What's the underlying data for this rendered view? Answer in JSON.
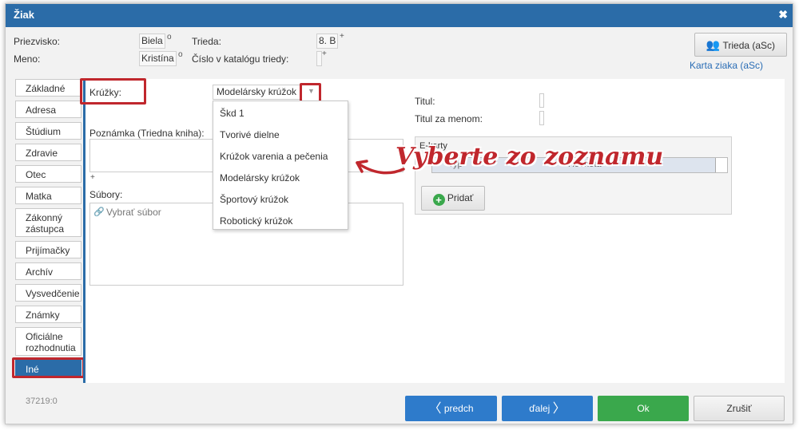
{
  "window": {
    "title": "Žiak"
  },
  "header": {
    "priezvisko_label": "Priezvisko:",
    "priezvisko_value": "Biela",
    "priezvisko_sup": "o",
    "meno_label": "Meno:",
    "meno_value": "Kristína",
    "meno_sup": "o",
    "trieda_label": "Trieda:",
    "trieda_value": "8. B",
    "trieda_sup": "+",
    "cislo_label": "Číslo v katalógu triedy:",
    "cislo_sup": "+",
    "trieda_button": "Trieda (aSc)",
    "karta_link": "Karta ziaka (aSc)"
  },
  "sidebar": {
    "items": [
      {
        "label": "Základné"
      },
      {
        "label": "Adresa"
      },
      {
        "label": "Štúdium"
      },
      {
        "label": "Zdravie"
      },
      {
        "label": "Otec"
      },
      {
        "label": "Matka"
      },
      {
        "label": "Zákonný zástupca"
      },
      {
        "label": "Prijímačky"
      },
      {
        "label": "Archív"
      },
      {
        "label": "Vysvedčenie"
      },
      {
        "label": "Známky"
      },
      {
        "label": "Oficiálne rozhodnutia"
      },
      {
        "label": "Iné"
      }
    ],
    "active": "Iné"
  },
  "main": {
    "kruzky_label": "Krúžky:",
    "kruzky_value": "Modelársky krúžok",
    "dropdown_options": [
      "Škd 1",
      "Tvorivé dielne",
      "Krúžok varenia a pečenia",
      "Modelársky krúžok",
      "Športový krúžok",
      "Robotický krúžok"
    ],
    "poznamka_label": "Poznámka (Triedna kniha):",
    "plus": "+",
    "subory_label": "Súbory:",
    "vybrat_subor": "Vybrať súbor",
    "titul_label": "Titul:",
    "titul_za_menom_label": "Titul za menom:",
    "ekarty_label": "E-karty",
    "col_typ": "Typ",
    "col_hodnota": "Hodnota",
    "pridat_button": "Pridať"
  },
  "annotation": {
    "text": "Vyberte zo zoznamu"
  },
  "footer": {
    "id_text": "37219:0",
    "predch_button": "predch",
    "dalej_button": "ďalej",
    "ok_button": "Ok",
    "zrusit_button": "Zrušiť"
  },
  "colors": {
    "accent": "#2b6ca8",
    "highlight": "#c0272d",
    "ok": "#3aa84c",
    "nav": "#2e7bcb"
  }
}
